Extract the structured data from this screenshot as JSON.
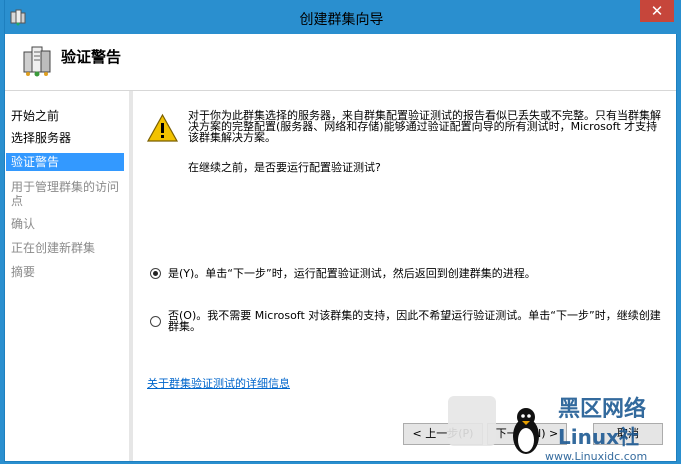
{
  "window": {
    "title": "创建群集向导",
    "close_glyph": "✕"
  },
  "header": {
    "title": "验证警告"
  },
  "steps": [
    {
      "label": "开始之前",
      "state": "normal"
    },
    {
      "label": "选择服务器",
      "state": "normal"
    },
    {
      "label": "验证警告",
      "state": "active"
    },
    {
      "label": "用于管理群集的访问点",
      "state": "inactive"
    },
    {
      "label": "确认",
      "state": "inactive"
    },
    {
      "label": "正在创建新群集",
      "state": "inactive"
    },
    {
      "label": "摘要",
      "state": "inactive"
    }
  ],
  "content": {
    "warning_text": "对于你为此群集选择的服务器，来自群集配置验证测试的报告看似已丢失或不完整。只有当群集解决方案的完整配置(服务器、网络和存储)能够通过验证配置向导的所有测试时，Microsoft 才支持该群集解决方案。",
    "prompt": "在继续之前，是否要运行配置验证测试?",
    "options": [
      {
        "label": "是(Y)。单击“下一步”时，运行配置验证测试，然后返回到创建群集的进程。",
        "checked": true
      },
      {
        "label": "否(O)。我不需要 Microsoft 对该群集的支持，因此不希望运行验证测试。单击“下一步”时，继续创建群集。",
        "checked": false
      }
    ],
    "link": "关于群集验证测试的详细信息"
  },
  "buttons": {
    "back": "< 上一步(P)",
    "next": "下一步(N) >",
    "cancel": "取消"
  },
  "watermark": {
    "line1": "黑区网络",
    "line2": "Linux社",
    "url": "www.Linuxidc.com"
  },
  "colors": {
    "titlebar": "#2a8fcf",
    "active_step": "#3399ff",
    "link": "#0066cc",
    "close": "#c6463b"
  }
}
